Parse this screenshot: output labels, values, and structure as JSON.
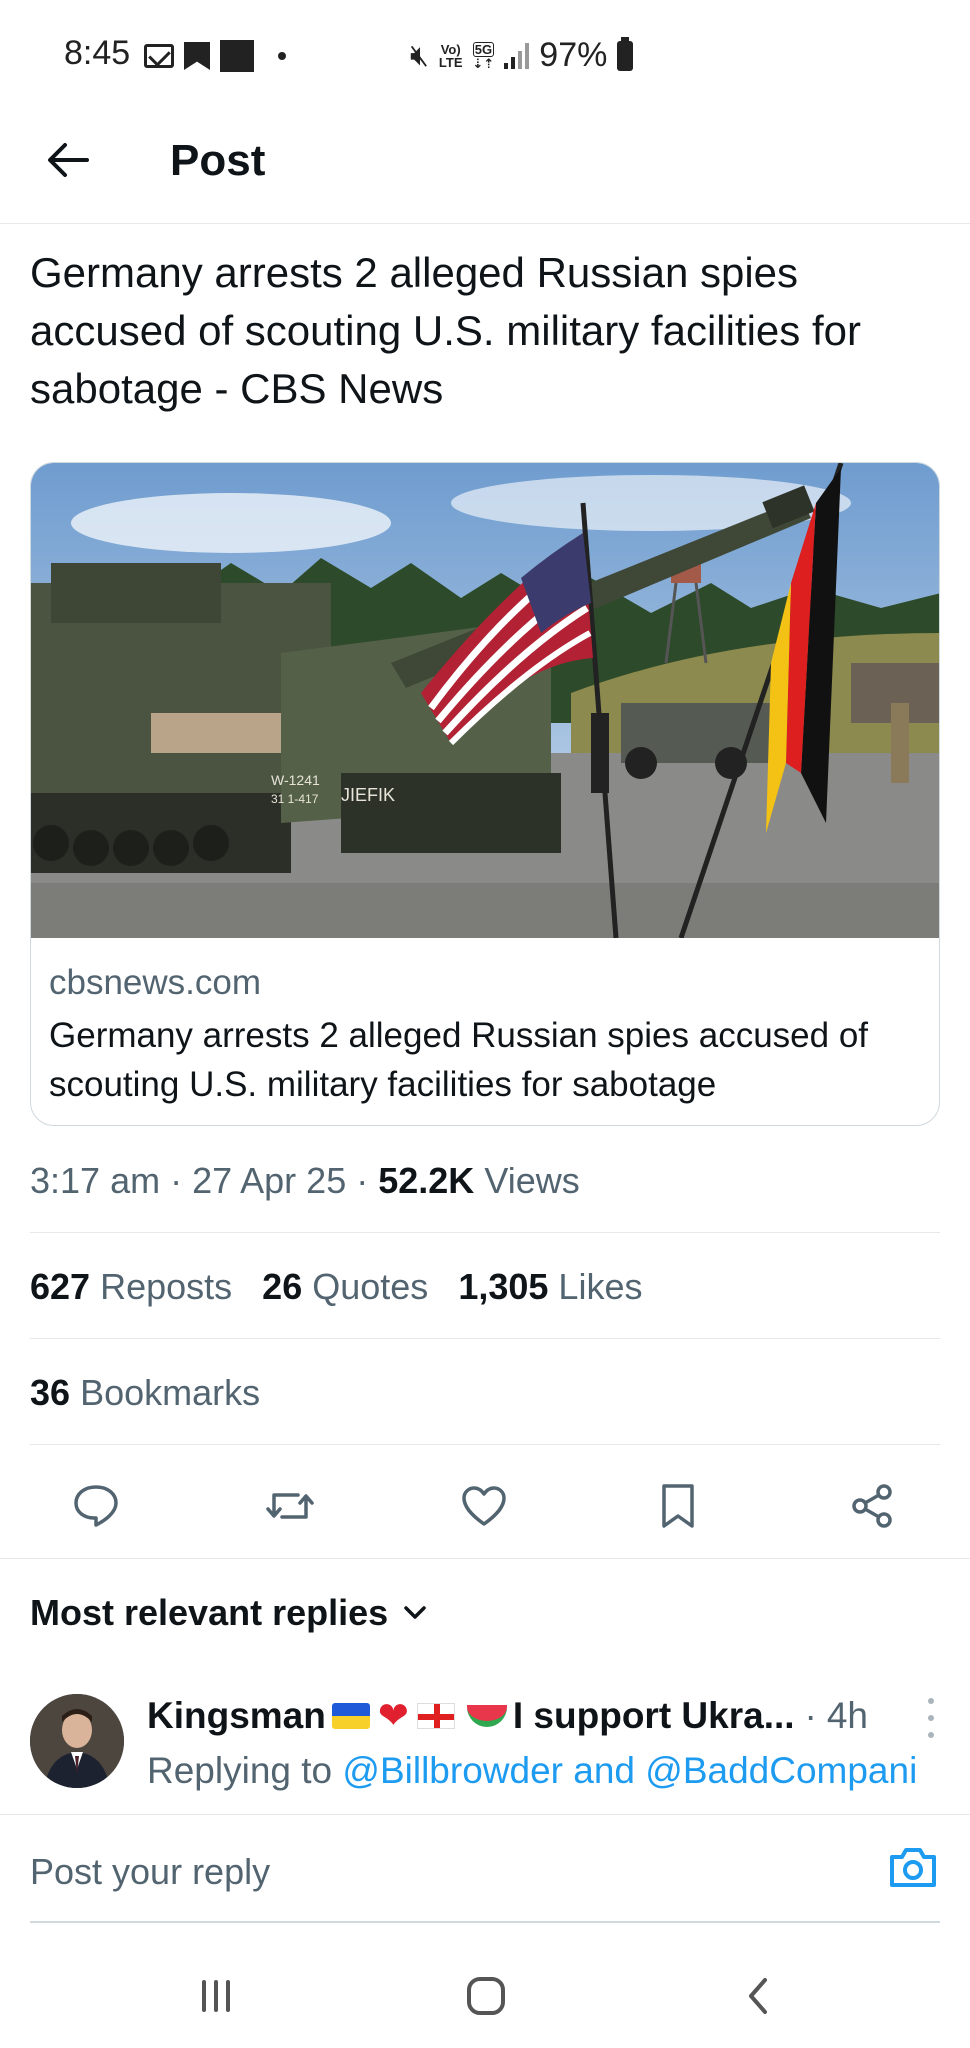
{
  "status_bar": {
    "time": "8:45",
    "network_top": "Vo)",
    "network_bottom": "LTE",
    "gen_top": "5G",
    "gen_bottom": "⇣⇡",
    "battery": "97%"
  },
  "header": {
    "title": "Post"
  },
  "post": {
    "text": "Germany arrests 2 alleged Russian spies accused of scouting U.S. military facilities for sabotage - CBS News",
    "card": {
      "domain": "cbsnews.com",
      "title": "Germany arrests 2 alleged Russian spies accused of scouting U.S. military facilities for sabotage",
      "image_label_left": "W-1241",
      "image_label_left2": "31 1-417",
      "image_label_right": "JIEFIK"
    },
    "time": "3:17 am",
    "date": "27 Apr 25",
    "views_count": "52.2K",
    "views_label": "Views",
    "reposts_count": "627",
    "reposts_label": "Reposts",
    "quotes_count": "26",
    "quotes_label": "Quotes",
    "likes_count": "1,305",
    "likes_label": "Likes",
    "bookmarks_count": "36",
    "bookmarks_label": "Bookmarks"
  },
  "replies": {
    "header": "Most relevant replies",
    "items": [
      {
        "name_prefix": "Kingsman",
        "name_suffix": "I support Ukra...",
        "time": "4h",
        "replying_label": "Replying to",
        "mentions": "@Billbrowder and @BaddCompani"
      }
    ]
  },
  "composer": {
    "placeholder": "Post your reply"
  },
  "colors": {
    "accent": "#1d9bf0",
    "text_primary": "#0f1419",
    "text_secondary": "#536471",
    "divider": "#e6e9ec"
  },
  "icons": [
    "back-arrow-icon",
    "reply-icon",
    "repost-icon",
    "like-icon",
    "bookmark-icon",
    "share-icon",
    "chevron-down-icon",
    "camera-icon",
    "more-icon",
    "recents-icon",
    "home-icon",
    "nav-back-icon"
  ]
}
